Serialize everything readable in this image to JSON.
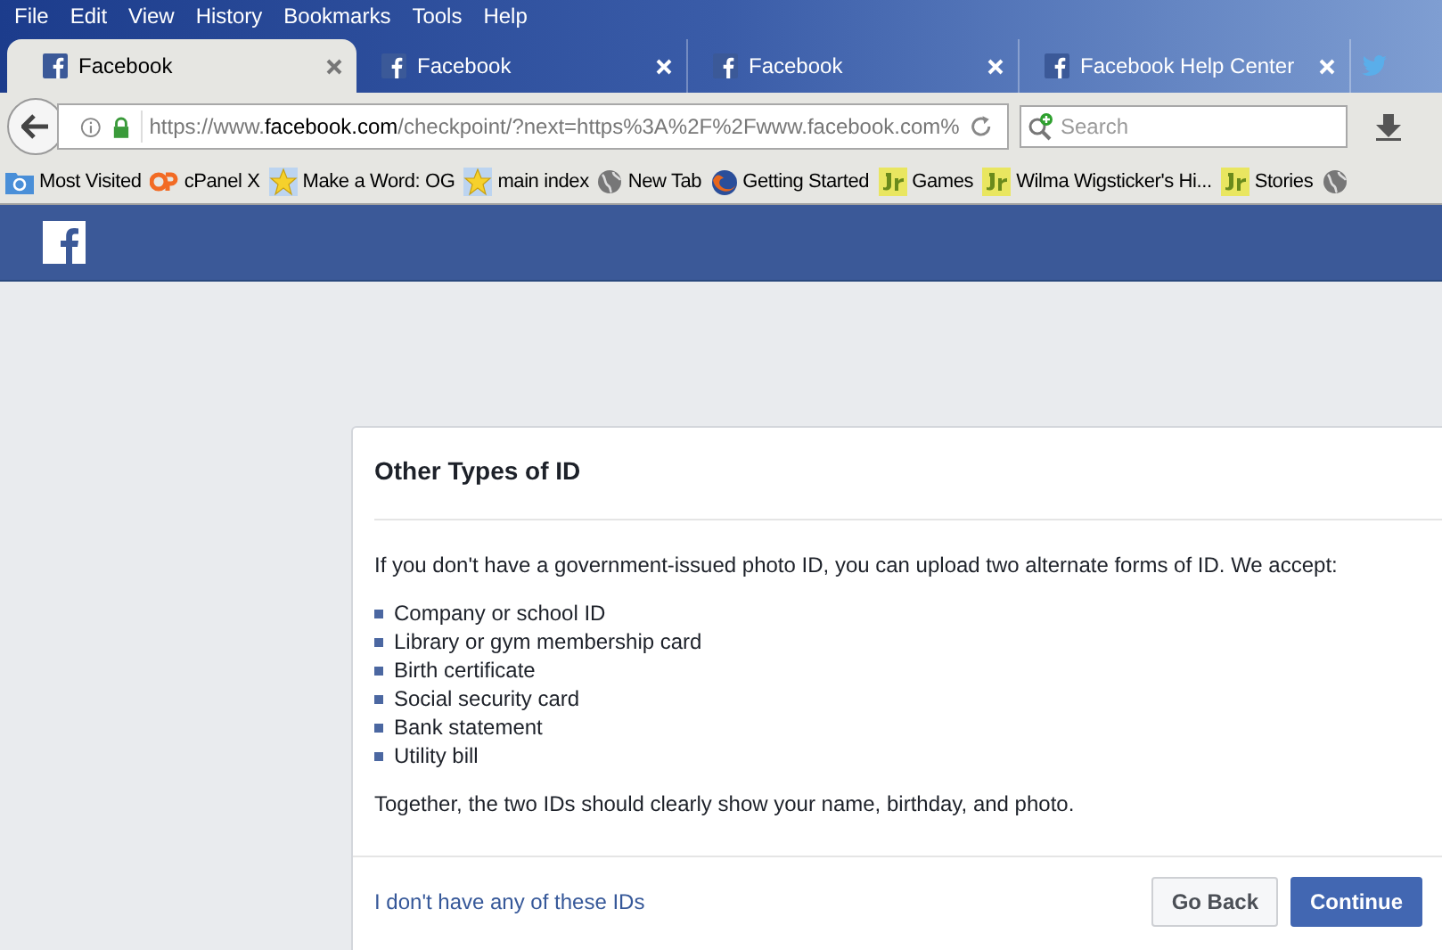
{
  "menu_bar": [
    "File",
    "Edit",
    "View",
    "History",
    "Bookmarks",
    "Tools",
    "Help"
  ],
  "tabs": [
    {
      "title": "Facebook",
      "selected": true
    },
    {
      "title": "Facebook",
      "selected": false
    },
    {
      "title": "Facebook",
      "selected": false
    },
    {
      "title": "Facebook Help Center",
      "selected": false
    }
  ],
  "address_bar": {
    "url_start": "https://www.",
    "url_domain": "facebook.com",
    "url_end": "/checkpoint/?next=https%3A%2F%2Fwww.facebook.com%"
  },
  "search": {
    "placeholder": "Search"
  },
  "bookmarks": [
    {
      "label": "Most Visited",
      "kind": "folder"
    },
    {
      "label": "cPanel X",
      "kind": "cpanel"
    },
    {
      "label": "Make a Word: OG",
      "kind": "star"
    },
    {
      "label": "main index",
      "kind": "star"
    },
    {
      "label": "New Tab",
      "kind": "globe"
    },
    {
      "label": "Getting Started",
      "kind": "browser"
    },
    {
      "label": "Games",
      "kind": "jr"
    },
    {
      "label": "Wilma Wigsticker's Hi...",
      "kind": "jr"
    },
    {
      "label": "Stories",
      "kind": "jr"
    }
  ],
  "dialog": {
    "title": "Other Types of ID",
    "intro": "If you don't have a government-issued photo ID, you can upload two alternate forms of ID. We accept:",
    "accepted_ids": [
      "Company or school ID",
      "Library or gym membership card",
      "Birth certificate",
      "Social security card",
      "Bank statement",
      "Utility bill"
    ],
    "note": "Together, the two IDs should clearly show your name, birthday, and photo.",
    "link": "I don't have any of these IDs",
    "buttons": [
      {
        "label": "Go Back",
        "kind": "secondary"
      },
      {
        "label": "Continue",
        "kind": "primary"
      }
    ]
  }
}
